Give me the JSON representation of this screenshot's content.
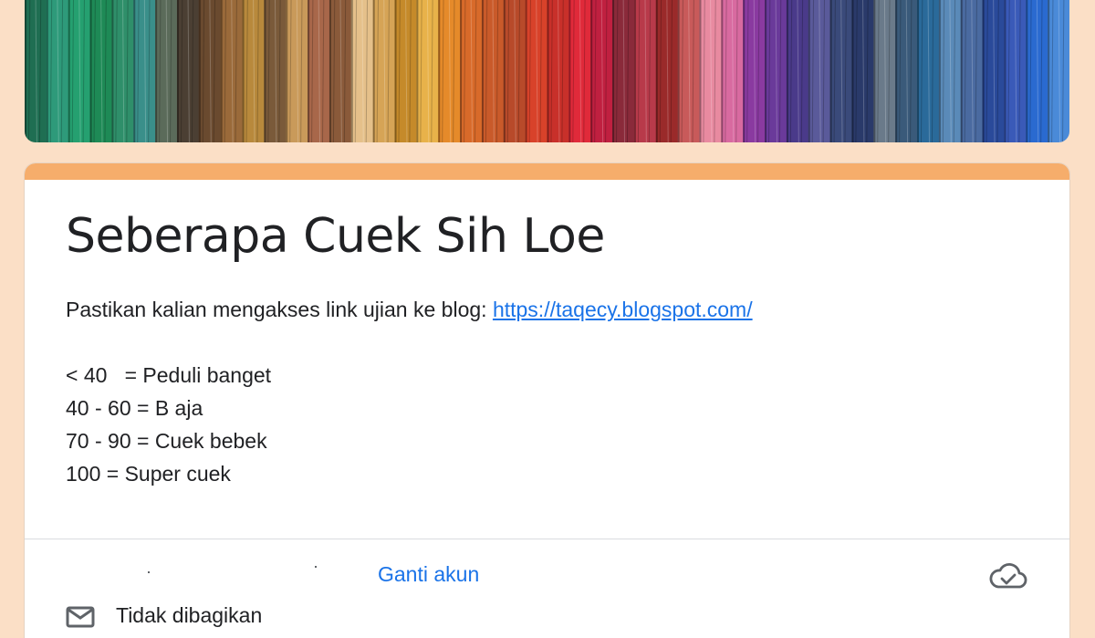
{
  "header": {
    "banner_image": "colorful yarn strands banner"
  },
  "form": {
    "title": "Seberapa Cuek Sih Loe",
    "description_prefix": "Pastikan kalian mengakses link ujian ke blog: ",
    "description_link": "https://taqecy.blogspot.com/",
    "score_lines": [
      "< 40   = Peduli banget",
      "40 - 60 = B aja",
      "70 - 90 = Cuek bebek",
      "100 = Super cuek"
    ]
  },
  "account": {
    "switch_label": "Ganti akun",
    "not_shared_label": "Tidak dibagikan",
    "cloud_icon": "cloud-check-icon",
    "mail_icon": "mail-icon"
  },
  "colors": {
    "page_bg": "#fbdfc6",
    "accent": "#f6ad6b",
    "link": "#1a73e8",
    "text": "#202124"
  }
}
